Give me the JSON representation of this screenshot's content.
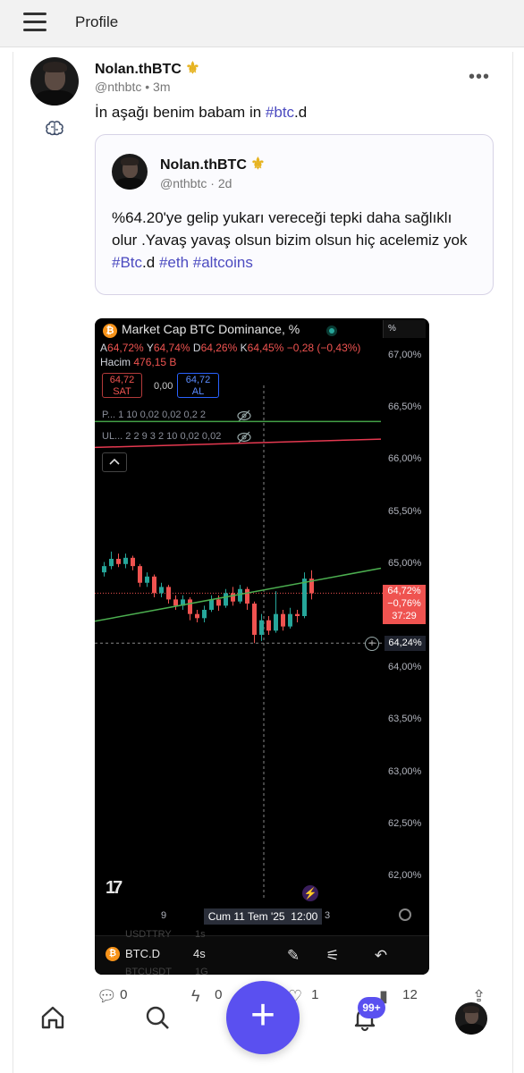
{
  "header": {
    "title": "Profile"
  },
  "post": {
    "author": "Nolan.thBTC",
    "handle": "@nthbtc",
    "separator": "•",
    "time": "3m",
    "text_pre": "İn aşağı benim babam in ",
    "text_tag": "#btc",
    "text_post": ".d"
  },
  "quote": {
    "author": "Nolan.thBTC",
    "handle": "@nthbtc",
    "separator": "·",
    "time": "2d",
    "text_main": "%64.20'ye gelip yukarı vereceği tepki daha sağlıklı olur .Yavaş yavaş olsun bizim olsun hiç acelemiz yok ",
    "tag1": "#Btc",
    "tag1_suffix": ".d ",
    "tag2": "#eth",
    "tag3": "#altcoins"
  },
  "chart_widget": {
    "title": "Market Cap BTC Dominance, %",
    "btc_glyph": "₿",
    "ohlc": {
      "a_label": "A",
      "a_val": "64,72%",
      "y_label": "Y",
      "y_val": "64,74%",
      "d_label": "D",
      "d_val": "64,26%",
      "k_label": "K",
      "k_val": "64,45%",
      "change": "−0,28 (−0,43%)"
    },
    "volume_label": "Hacim",
    "volume_val": "476,15 B",
    "sell_price": "64,72",
    "sell_label": "SAT",
    "spread": "0,00",
    "buy_price": "64,72",
    "buy_label": "AL",
    "indicator1": "P... 1 10 0,02 0,02 0,2 2",
    "indicator2": "UL... 2 2 9 3 2 10 0,02 0,02",
    "percent_btn": "%",
    "y_ticks": [
      "67,00%",
      "66,50%",
      "66,00%",
      "65,50%",
      "65,00%",
      "64,00%",
      "63,50%",
      "63,00%",
      "62,50%",
      "62,00%"
    ],
    "last_price": "64,72%",
    "last_change": "−0,76%",
    "countdown": "37:29",
    "crosshair_price": "64,24%",
    "x_tick_left": "9",
    "x_tick_right": "3",
    "crosshair_date": "Cum 11 Tem '25",
    "crosshair_time": "12:00",
    "ghost_sym1": "USDTTRY",
    "ghost_int1": "1s",
    "ghost_sym2": "BTCUSDT",
    "ghost_int2": "1G",
    "symbol": "BTC.D",
    "interval": "4s"
  },
  "chart_data": {
    "type": "candlestick",
    "title": "Market Cap BTC Dominance, %",
    "ylim": [
      61.9,
      67.2
    ],
    "y_unit": "%",
    "candles": [
      {
        "o": 64.92,
        "c": 64.98,
        "h": 65.02,
        "l": 64.88
      },
      {
        "o": 64.98,
        "c": 65.05,
        "h": 65.12,
        "l": 64.95
      },
      {
        "o": 65.05,
        "c": 65.0,
        "h": 65.1,
        "l": 64.97
      },
      {
        "o": 65.0,
        "c": 65.06,
        "h": 65.1,
        "l": 64.96
      },
      {
        "o": 65.06,
        "c": 64.98,
        "h": 65.08,
        "l": 64.94
      },
      {
        "o": 64.98,
        "c": 64.82,
        "h": 65.0,
        "l": 64.78
      },
      {
        "o": 64.82,
        "c": 64.88,
        "h": 64.92,
        "l": 64.78
      },
      {
        "o": 64.88,
        "c": 64.72,
        "h": 64.9,
        "l": 64.68
      },
      {
        "o": 64.72,
        "c": 64.78,
        "h": 64.82,
        "l": 64.68
      },
      {
        "o": 64.78,
        "c": 64.66,
        "h": 64.8,
        "l": 64.62
      },
      {
        "o": 64.66,
        "c": 64.6,
        "h": 64.7,
        "l": 64.56
      },
      {
        "o": 64.6,
        "c": 64.66,
        "h": 64.7,
        "l": 64.56
      },
      {
        "o": 64.66,
        "c": 64.52,
        "h": 64.68,
        "l": 64.46
      },
      {
        "o": 64.52,
        "c": 64.48,
        "h": 64.56,
        "l": 64.44
      },
      {
        "o": 64.48,
        "c": 64.56,
        "h": 64.6,
        "l": 64.44
      },
      {
        "o": 64.56,
        "c": 64.66,
        "h": 64.7,
        "l": 64.54
      },
      {
        "o": 64.66,
        "c": 64.6,
        "h": 64.7,
        "l": 64.55
      },
      {
        "o": 64.6,
        "c": 64.72,
        "h": 64.76,
        "l": 64.58
      },
      {
        "o": 64.72,
        "c": 64.64,
        "h": 64.78,
        "l": 64.6
      },
      {
        "o": 64.64,
        "c": 64.76,
        "h": 64.8,
        "l": 64.62
      },
      {
        "o": 64.76,
        "c": 64.62,
        "h": 64.78,
        "l": 64.56
      },
      {
        "o": 64.62,
        "c": 64.32,
        "h": 64.64,
        "l": 64.24
      },
      {
        "o": 64.32,
        "c": 64.46,
        "h": 64.52,
        "l": 64.26
      },
      {
        "o": 64.46,
        "c": 64.36,
        "h": 64.5,
        "l": 64.32
      },
      {
        "o": 64.36,
        "c": 64.52,
        "h": 64.74,
        "l": 64.34
      },
      {
        "o": 64.52,
        "c": 64.4,
        "h": 64.56,
        "l": 64.36
      },
      {
        "o": 64.4,
        "c": 64.52,
        "h": 64.58,
        "l": 64.38
      },
      {
        "o": 64.52,
        "c": 64.5,
        "h": 64.56,
        "l": 64.44
      },
      {
        "o": 64.5,
        "c": 64.86,
        "h": 64.92,
        "l": 64.48
      },
      {
        "o": 64.86,
        "c": 64.72,
        "h": 64.94,
        "l": 64.66
      }
    ],
    "trendline_price": {
      "from": 64.45,
      "to": 64.96
    },
    "indicator_green_level": 66.37,
    "indicator_red_level": {
      "from": 66.12,
      "to": 66.2
    },
    "last_price_line": 64.72,
    "crosshair_price": 64.24,
    "candle_colors": {
      "up": "#26a69a",
      "down": "#ef5350"
    }
  },
  "actions": {
    "replies": "0",
    "boosts": "0",
    "likes": "1",
    "views": "12"
  },
  "nav": {
    "notifications_badge": "99+"
  },
  "colors": {
    "accent": "#5a50f0",
    "hashtag": "#4c4bc0",
    "gold": "#e6b320"
  }
}
